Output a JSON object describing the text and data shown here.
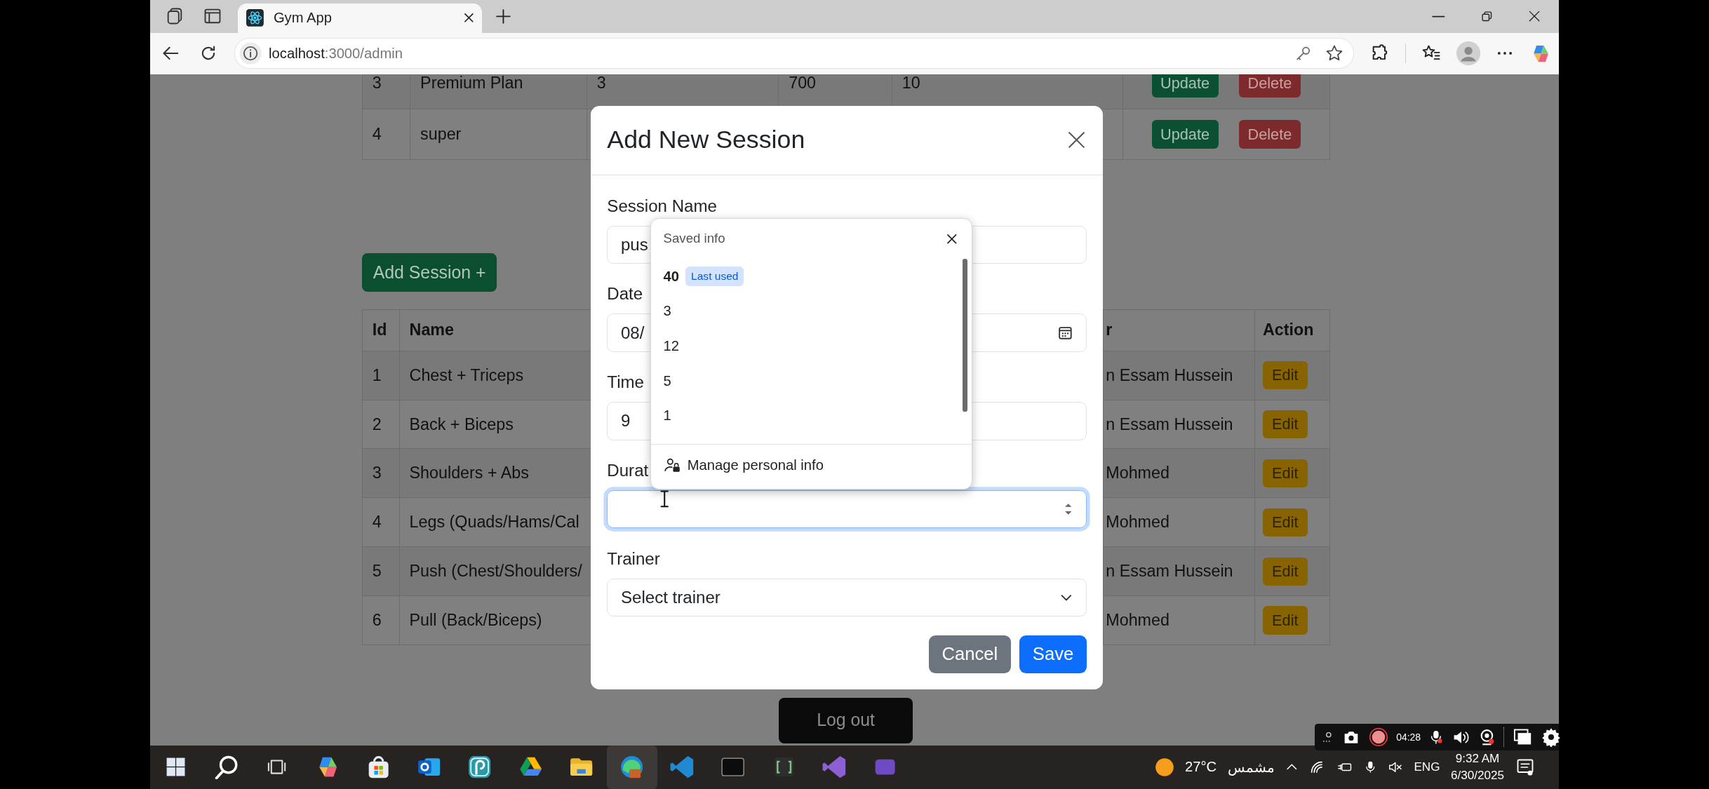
{
  "browser": {
    "tab": {
      "title": "Gym App"
    },
    "address": {
      "host": "localhost",
      "path": ":3000/admin"
    }
  },
  "plans_table": {
    "rows": [
      {
        "id": "3",
        "name": "Premium Plan",
        "column_3": "3",
        "column_4": "700",
        "column_5": "10",
        "actions": [
          "Update",
          "Delete"
        ]
      },
      {
        "id": "4",
        "name": "super",
        "actions": [
          "Update",
          "Delete"
        ]
      }
    ]
  },
  "add_session_button": "Add Session +",
  "sessions_table": {
    "columns": [
      "Id",
      "Name",
      "r",
      "Action"
    ],
    "rows": [
      {
        "id": "1",
        "name": "Chest + Triceps",
        "trainer": "n Essam Hussein",
        "action": "Edit"
      },
      {
        "id": "2",
        "name": "Back + Biceps",
        "trainer": "n Essam Hussein",
        "action": "Edit"
      },
      {
        "id": "3",
        "name": "Shoulders + Abs",
        "trainer": "Mohmed",
        "action": "Edit"
      },
      {
        "id": "4",
        "name": "Legs (Quads/Hams/Cal",
        "trainer": "Mohmed",
        "action": "Edit"
      },
      {
        "id": "5",
        "name": "Push (Chest/Shoulders/",
        "trainer": "n Essam Hussein",
        "action": "Edit"
      },
      {
        "id": "6",
        "name": "Pull (Back/Biceps)",
        "trainer": "Mohmed",
        "action": "Edit"
      }
    ]
  },
  "logout_button": "Log out",
  "modal": {
    "title": "Add New Session",
    "fields": [
      {
        "label": "Session Name",
        "kind": "text",
        "value": "pus",
        "focused": false
      },
      {
        "label": "Date",
        "kind": "date",
        "value": "08/",
        "focused": false
      },
      {
        "label": "Time",
        "kind": "text",
        "value": "9",
        "focused": false
      },
      {
        "label": "Durat",
        "kind": "number",
        "focused": true
      },
      {
        "label": "Trainer",
        "kind": "select",
        "value": "Select trainer",
        "focused": false
      }
    ],
    "buttons": [
      {
        "label": "Cancel",
        "kind": "secondary"
      },
      {
        "label": "Save",
        "kind": "primary"
      }
    ]
  },
  "autofill": {
    "title": "Saved info",
    "items": [
      {
        "value": "40",
        "badge": "Last used"
      },
      {
        "value": "3"
      },
      {
        "value": "12"
      },
      {
        "value": "5"
      },
      {
        "value": "1"
      }
    ],
    "footer": "Manage personal info"
  },
  "recorder": {
    "time": "04:28"
  },
  "taskbar": {
    "weather": {
      "temperature": "27°C",
      "condition": "مشمس"
    },
    "language": "ENG",
    "time": "9:32 AM",
    "date": "6/30/2025"
  }
}
